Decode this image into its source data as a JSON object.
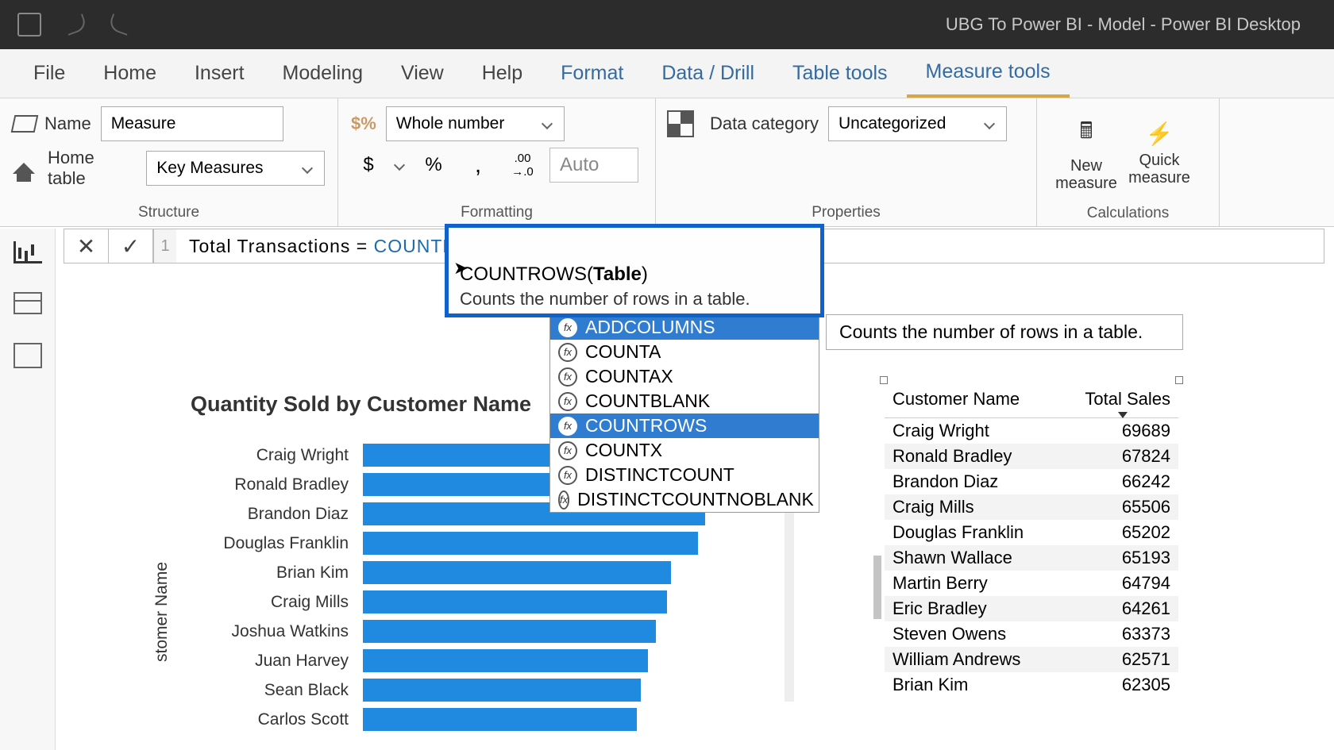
{
  "window": {
    "title": "UBG To Power BI - Model - Power BI Desktop"
  },
  "tabs": {
    "file": "File",
    "home": "Home",
    "insert": "Insert",
    "modeling": "Modeling",
    "view": "View",
    "help": "Help",
    "format": "Format",
    "datadrill": "Data / Drill",
    "tabletools": "Table tools",
    "measuretools": "Measure tools"
  },
  "ribbon": {
    "structure": {
      "label": "Structure",
      "name_label": "Name",
      "name_value": "Measure",
      "home_table_label": "Home table",
      "home_table_value": "Key Measures"
    },
    "formatting": {
      "label": "Formatting",
      "format_value": "Whole number",
      "auto": "Auto",
      "currency": "$",
      "percent": "%",
      "comma": ",",
      "decimals_btn": ".00→.0"
    },
    "properties": {
      "label": "Properties",
      "data_category_label": "Data category",
      "data_category_value": "Uncategorized"
    },
    "calculations": {
      "label": "Calculations",
      "new_measure": "New measure",
      "quick_measure": "Quick measure"
    }
  },
  "formula": {
    "line": "1",
    "prefix": "Total Transactions = ",
    "fn": "COUNTROWS(",
    "signature_fn": "COUNTROWS(",
    "signature_arg": "Table",
    "signature_close": ")",
    "description": "Counts the number of rows in a table."
  },
  "intellisense": {
    "items": [
      {
        "label": "ADDCOLUMNS",
        "hl": true
      },
      {
        "label": "COUNTA",
        "hl": false
      },
      {
        "label": "COUNTAX",
        "hl": false
      },
      {
        "label": "COUNTBLANK",
        "hl": false
      },
      {
        "label": "COUNTROWS",
        "hl": true
      },
      {
        "label": "COUNTX",
        "hl": false
      },
      {
        "label": "DISTINCTCOUNT",
        "hl": false
      },
      {
        "label": "DISTINCTCOUNTNOBLANK",
        "hl": false
      }
    ]
  },
  "side_tooltip": "Counts the number of rows in a table.",
  "chart_data": {
    "type": "bar",
    "title": "Quantity Sold by Customer Name",
    "y_axis_label": "Customer Name",
    "categories": [
      "Craig Wright",
      "Ronald Bradley",
      "Brandon Diaz",
      "Douglas Franklin",
      "Brian Kim",
      "Craig Mills",
      "Joshua Watkins",
      "Juan Harvey",
      "Sean Black",
      "Carlos Scott"
    ],
    "values": [
      480,
      465,
      450,
      440,
      405,
      400,
      385,
      375,
      365,
      360
    ]
  },
  "table": {
    "columns": [
      "Customer Name",
      "Total Sales"
    ],
    "rows": [
      {
        "name": "Craig Wright",
        "sales": 69689
      },
      {
        "name": "Ronald Bradley",
        "sales": 67824
      },
      {
        "name": "Brandon Diaz",
        "sales": 66242
      },
      {
        "name": "Craig Mills",
        "sales": 65506
      },
      {
        "name": "Douglas Franklin",
        "sales": 65202
      },
      {
        "name": "Shawn Wallace",
        "sales": 65193
      },
      {
        "name": "Martin Berry",
        "sales": 64794
      },
      {
        "name": "Eric Bradley",
        "sales": 64261
      },
      {
        "name": "Steven Owens",
        "sales": 63373
      },
      {
        "name": "William Andrews",
        "sales": 62571
      },
      {
        "name": "Brian Kim",
        "sales": 62305
      }
    ]
  }
}
